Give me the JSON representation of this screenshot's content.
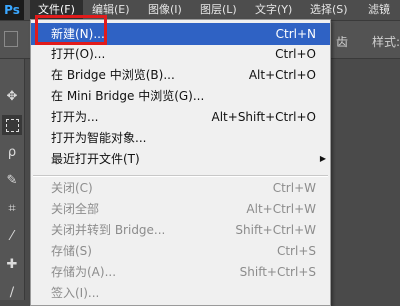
{
  "app": {
    "logo": "Ps"
  },
  "menubar": {
    "items": [
      {
        "label": "文件(F)"
      },
      {
        "label": "编辑(E)"
      },
      {
        "label": "图像(I)"
      },
      {
        "label": "图层(L)"
      },
      {
        "label": "文字(Y)"
      },
      {
        "label": "选择(S)"
      },
      {
        "label": "滤镜"
      }
    ]
  },
  "optionsbar": {
    "text_1": "齿",
    "text_2": "样式:"
  },
  "file_menu": {
    "items": [
      {
        "label": "新建(N)...",
        "shortcut": "Ctrl+N"
      },
      {
        "label": "打开(O)...",
        "shortcut": "Ctrl+O"
      },
      {
        "label": "在 Bridge 中浏览(B)...",
        "shortcut": "Alt+Ctrl+O"
      },
      {
        "label": "在 Mini Bridge 中浏览(G)...",
        "shortcut": ""
      },
      {
        "label": "打开为...",
        "shortcut": "Alt+Shift+Ctrl+O"
      },
      {
        "label": "打开为智能对象...",
        "shortcut": ""
      },
      {
        "label": "最近打开文件(T)",
        "shortcut": ""
      },
      {
        "label": "关闭(C)",
        "shortcut": "Ctrl+W"
      },
      {
        "label": "关闭全部",
        "shortcut": "Alt+Ctrl+W"
      },
      {
        "label": "关闭并转到 Bridge...",
        "shortcut": "Shift+Ctrl+W"
      },
      {
        "label": "存储(S)",
        "shortcut": "Ctrl+S"
      },
      {
        "label": "存储为(A)...",
        "shortcut": "Shift+Ctrl+S"
      },
      {
        "label": "签入(I)...",
        "shortcut": ""
      }
    ]
  },
  "colors": {
    "highlight": "#2f62c4",
    "annotation": "#e11b1b",
    "logo": "#3aa7ff"
  }
}
